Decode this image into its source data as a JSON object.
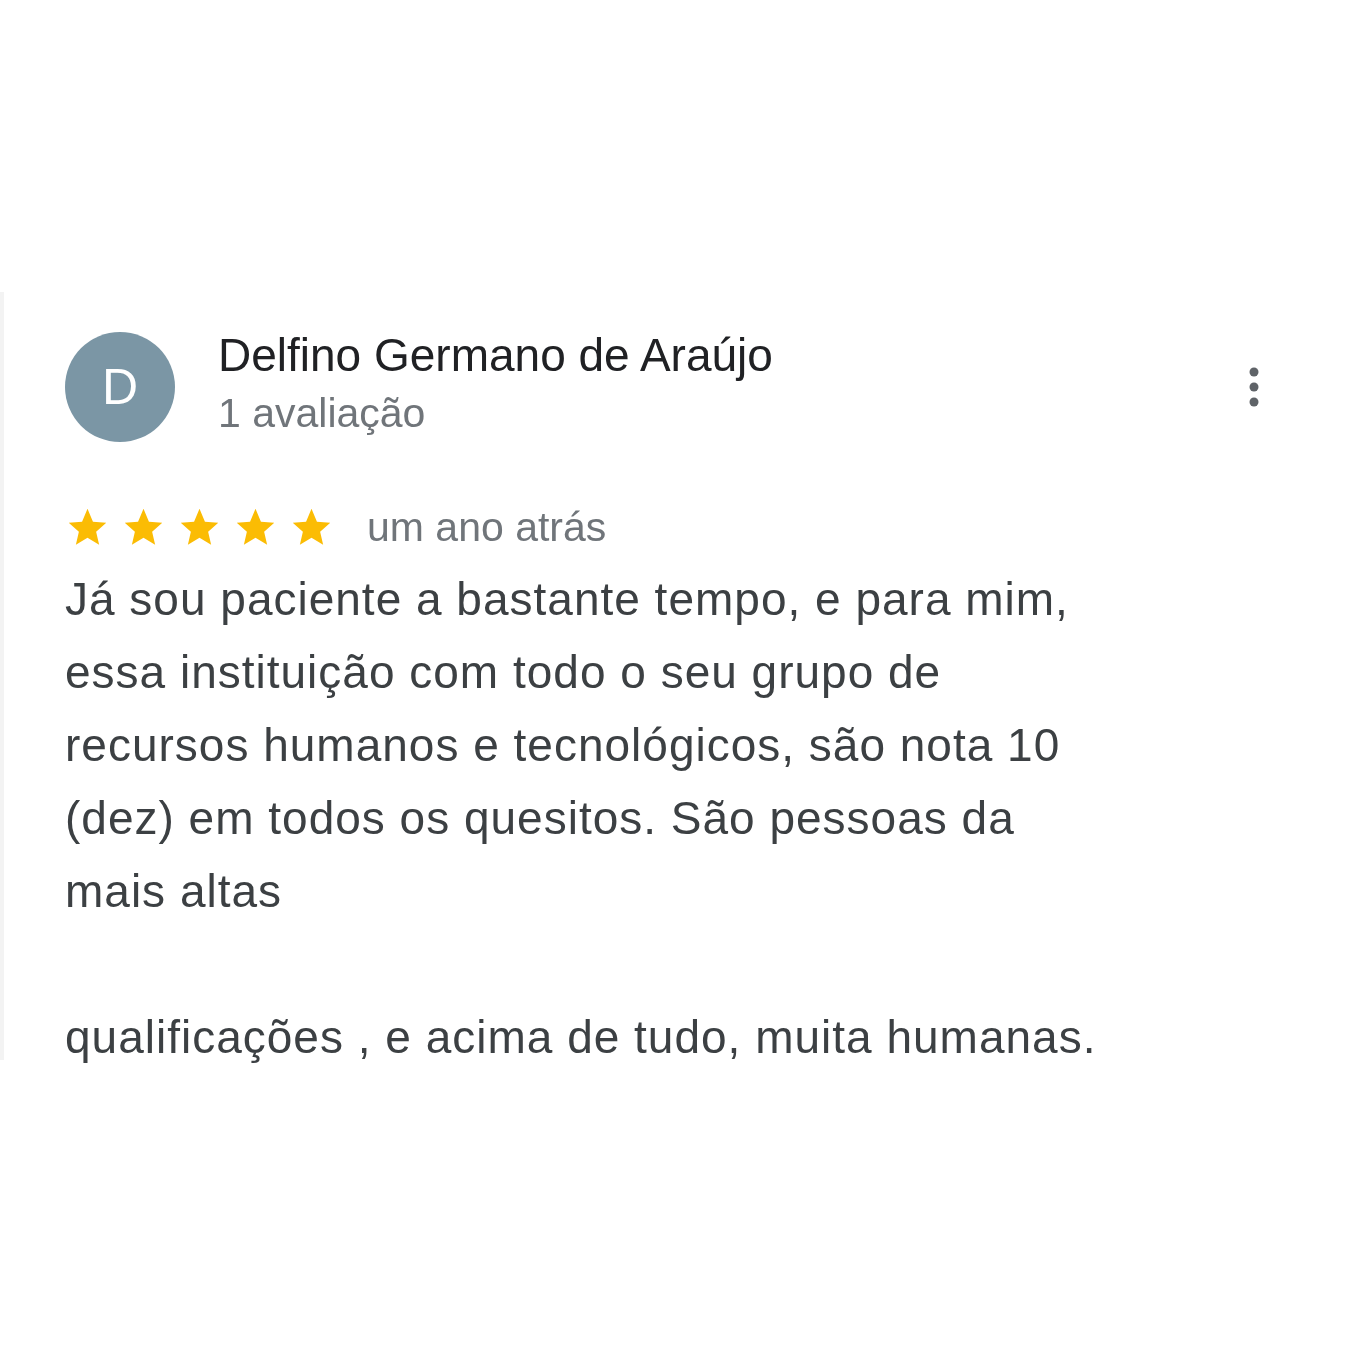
{
  "review": {
    "avatar_letter": "D",
    "author": "Delfino Germano de Araújo",
    "author_meta": "1 avaliação",
    "stars": 5,
    "time": "um ano atrás",
    "paragraphs": [
      "Já sou paciente a bastante tempo, e para mim, essa instituição com todo o seu grupo de recursos humanos e tecnológicos, são nota 10 (dez) em todos os quesitos. São pessoas da mais altas",
      "qualificações , e acima de tudo, muita humanas."
    ]
  }
}
